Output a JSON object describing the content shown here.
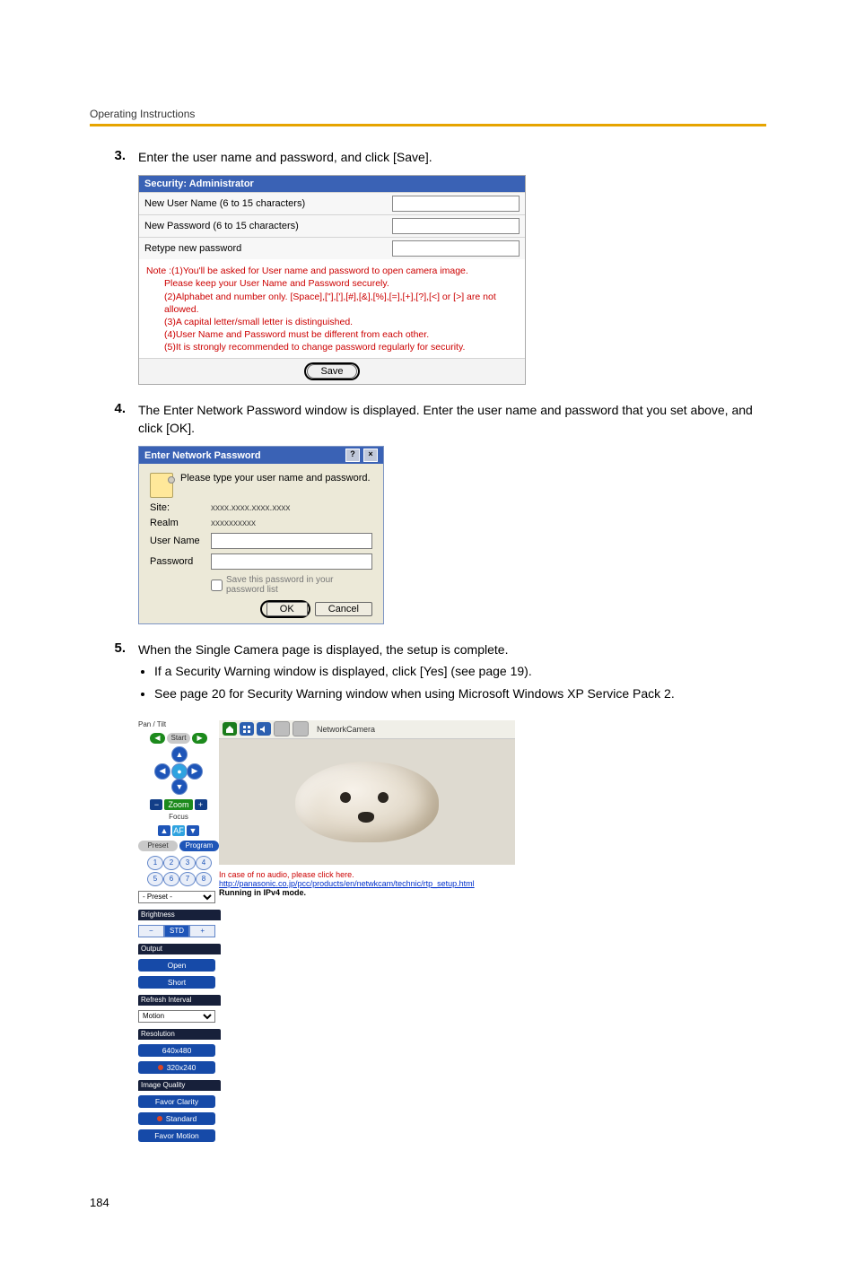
{
  "header": {
    "running": "Operating Instructions"
  },
  "steps": {
    "s3": {
      "num": "3.",
      "text": "Enter the user name and password, and click [Save]."
    },
    "s4": {
      "num": "4.",
      "text": "The Enter Network Password window is displayed. Enter the user name and password that you set above, and click [OK]."
    },
    "s5": {
      "num": "5.",
      "text": "When the Single Camera page is displayed, the setup is complete.",
      "b1": "If a Security Warning window is displayed, click [Yes] (see page 19).",
      "b2": "See page 20 for Security Warning window when using Microsoft Windows XP Service Pack 2."
    }
  },
  "secAdmin": {
    "title": "Security: Administrator",
    "row1": "New User Name (6 to 15 characters)",
    "row2": "New Password (6 to 15 characters)",
    "row3": "Retype new password",
    "note_lead": "Note :",
    "note1": "(1)You'll be asked for User name and password to open camera image.",
    "note1b": "Please keep your User Name and Password securely.",
    "note2": "(2)Alphabet and number only. [Space],[\"],['],[#],[&],[%],[=],[+],[?],[<] or [>] are not allowed.",
    "note3": "(3)A capital letter/small letter is distinguished.",
    "note4": "(4)User Name and Password must be different from each other.",
    "note5": "(5)It is strongly recommended to change password regularly for security.",
    "save": "Save"
  },
  "enp": {
    "title": "Enter Network Password",
    "help": "?",
    "close": "×",
    "prompt": "Please type your user name and password.",
    "site_l": "Site:",
    "site_v": "xxxx.xxxx.xxxx.xxxx",
    "realm_l": "Realm",
    "realm_v": "xxxxxxxxxx",
    "user_l": "User Name",
    "pass_l": "Password",
    "save_chk": "Save this password in your password list",
    "ok": "OK",
    "cancel": "Cancel"
  },
  "cam": {
    "topbar_title": "NetworkCamera",
    "pan_tilt": "Pan / Tilt",
    "start": "Start",
    "zoom": "Zoom",
    "focus": "Focus",
    "preset": "Preset",
    "program": "Program",
    "preset_sel": "- Preset -",
    "brightness": "Brightness",
    "std": "STD",
    "output": "Output",
    "open": "Open",
    "short": "Short",
    "refresh": "Refresh Interval",
    "motion": "Motion",
    "resolution": "Resolution",
    "res1": "640x480",
    "res2": "320x240",
    "iq": "Image Quality",
    "iq1": "Favor Clarity",
    "iq2": "Standard",
    "iq3": "Favor Motion",
    "msg": "In case of no audio, please click here.",
    "link": "http://panasonic.co.jp/pcc/products/en/netwkcam/technic/rtp_setup.html",
    "mode": "Running in IPv4 mode."
  },
  "pagenum": "184"
}
